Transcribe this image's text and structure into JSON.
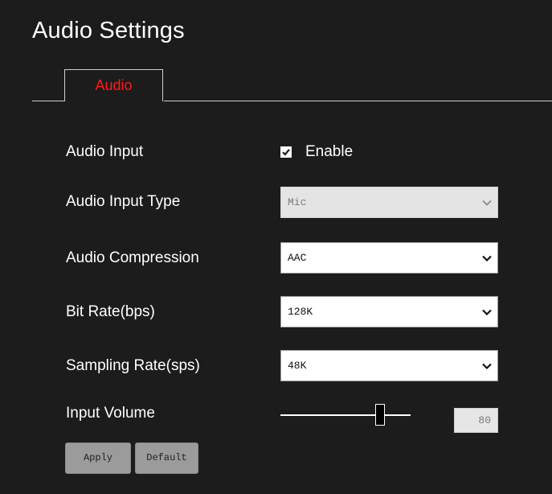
{
  "page": {
    "title": "Audio Settings"
  },
  "tabs": [
    {
      "label": "Audio",
      "active": true,
      "color": "#ff1a1a"
    }
  ],
  "form": {
    "audio_input": {
      "label": "Audio Input",
      "checkbox_label": "Enable",
      "checked": true
    },
    "audio_input_type": {
      "label": "Audio Input Type",
      "value": "Mic",
      "disabled": true
    },
    "audio_compression": {
      "label": "Audio Compression",
      "value": "AAC"
    },
    "bit_rate": {
      "label": "Bit Rate(bps)",
      "value": "128K"
    },
    "sampling_rate": {
      "label": "Sampling Rate(sps)",
      "value": "48K"
    },
    "input_volume": {
      "label": "Input Volume",
      "value": "80",
      "level": 0.8
    }
  },
  "buttons": {
    "apply_label": "Apply",
    "default_label": "Default"
  },
  "icons": {
    "checkbox": "check-icon",
    "dropdown": "chevron-down-icon"
  },
  "colors": {
    "background": "#1c1c1c",
    "active_tab_text": "#ff1a1a",
    "button_bg": "#9b9b9b"
  }
}
